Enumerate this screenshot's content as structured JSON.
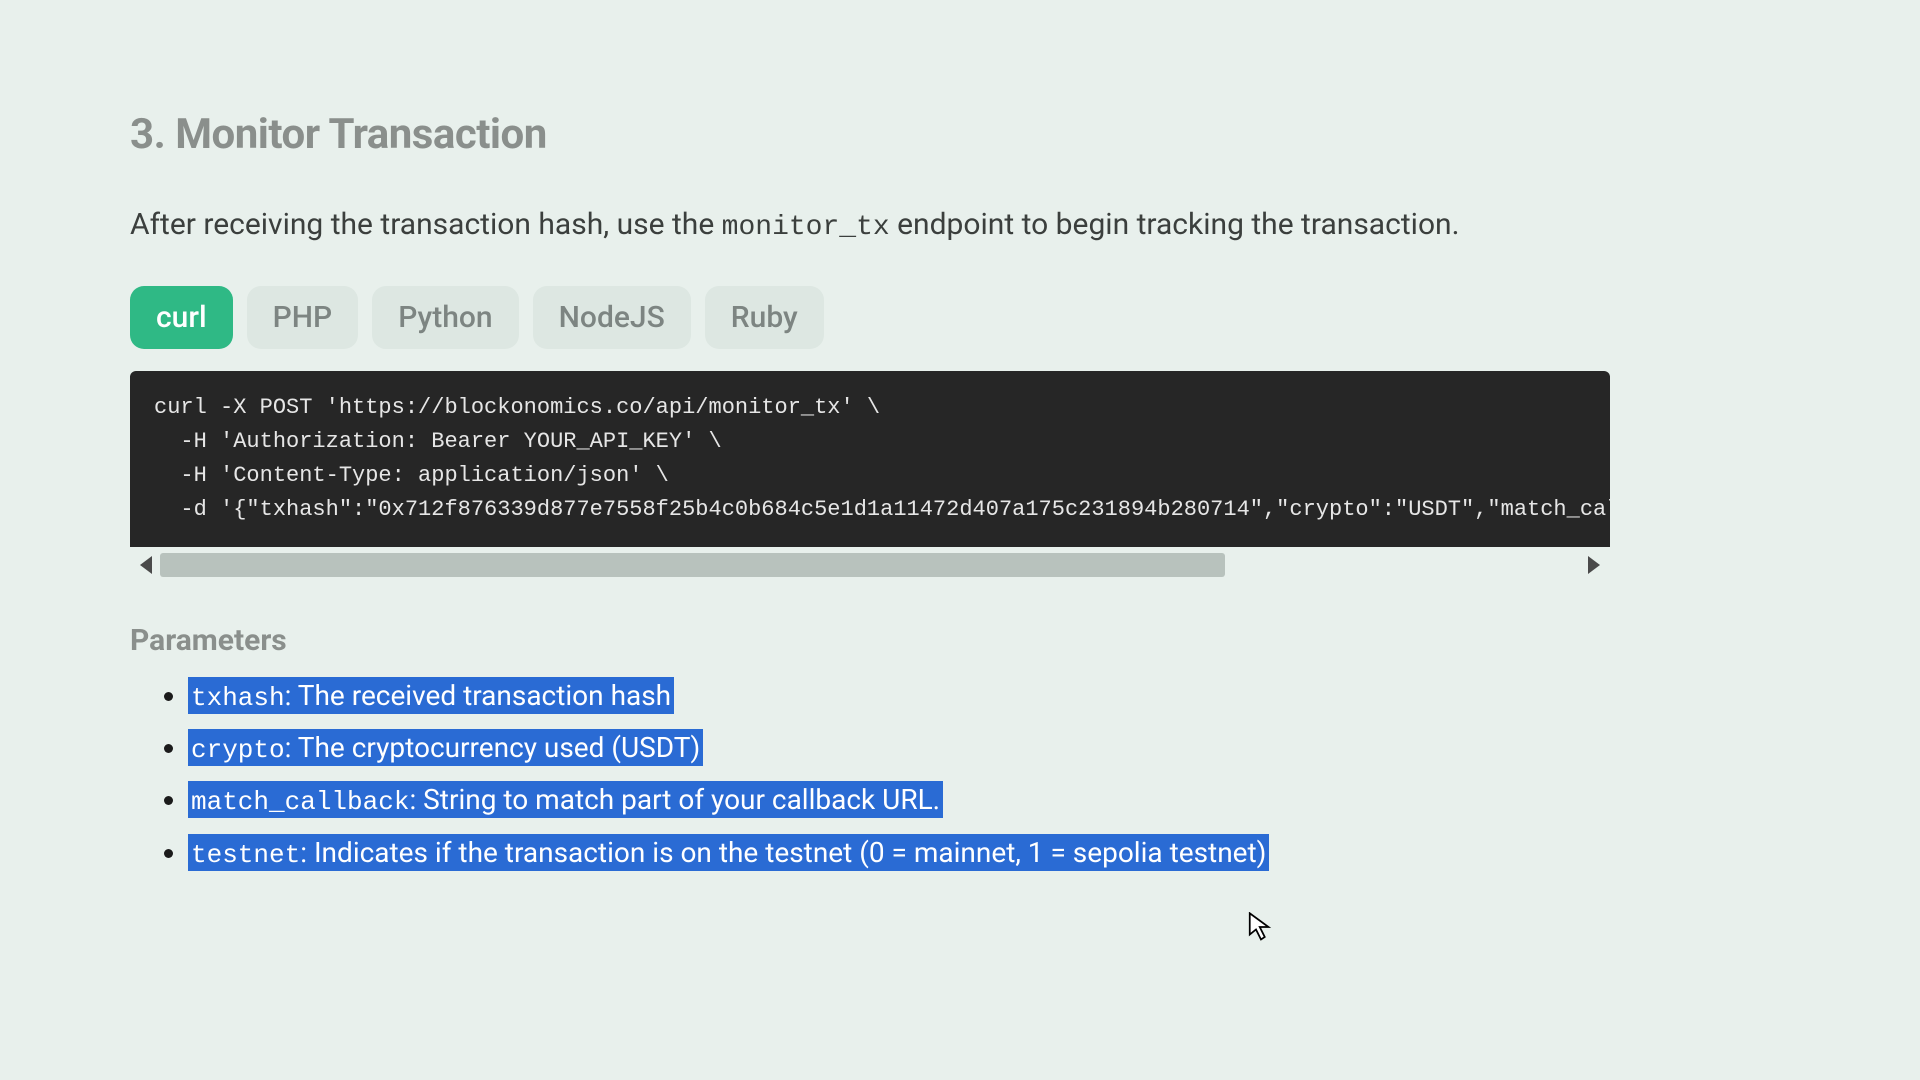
{
  "section": {
    "title": "3. Monitor Transaction",
    "intro_before": "After receiving the transaction hash, use the ",
    "intro_code": "monitor_tx",
    "intro_after": " endpoint to begin tracking the transaction."
  },
  "tabs": {
    "curl": "curl",
    "php": "PHP",
    "python": "Python",
    "nodejs": "NodeJS",
    "ruby": "Ruby",
    "active": "curl"
  },
  "code": "curl -X POST 'https://blockonomics.co/api/monitor_tx' \\\n  -H 'Authorization: Bearer YOUR_API_KEY' \\\n  -H 'Content-Type: application/json' \\\n  -d '{\"txhash\":\"0x712f876339d877e7558f25b4c0b684c5e1d1a11472d407a175c231894b280714\",\"crypto\":\"USDT\",\"match_callbac",
  "parameters": {
    "heading": "Parameters",
    "items": [
      {
        "name": "txhash",
        "desc": ": The received transaction hash"
      },
      {
        "name": "crypto",
        "desc": ": The cryptocurrency used (USDT)"
      },
      {
        "name": "match_callback",
        "desc": ": String to match part of your callback URL."
      },
      {
        "name": "testnet",
        "desc": ": Indicates if the transaction is on the testnet (0 = mainnet, 1 = sepolia testnet)"
      }
    ]
  }
}
